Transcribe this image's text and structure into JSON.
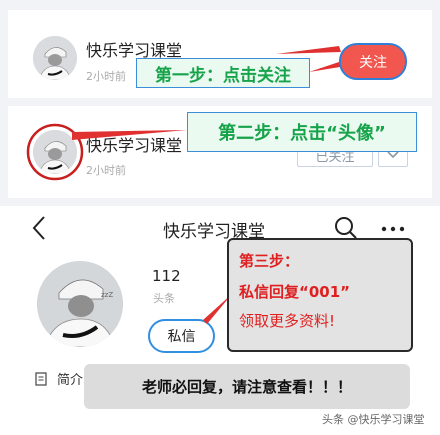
{
  "panel1": {
    "account_name": "快乐学习课堂",
    "time_text": "2小时前",
    "follow_label": "关注",
    "step_label": "第一步：点击关注"
  },
  "panel2": {
    "account_name": "快乐学习课堂",
    "time_text": "2小时前",
    "followed_label": "已关注",
    "step_label": "第二步：点击“头像”"
  },
  "profile": {
    "title": "快乐学习课堂",
    "stat_value": "112",
    "stat_label": "头条",
    "private_message_label": "私信",
    "intro_label": "简介"
  },
  "step3": {
    "title": "第三步：",
    "action": "私信回复“001”",
    "note": "领取更多资料!"
  },
  "bottom_notice": "老师必回复，请注意查看！！！",
  "watermark": "头条 @快乐学习课堂",
  "colors": {
    "accent_red": "#e03030",
    "follow_red": "#f2574f",
    "step_green": "#17a34a",
    "border_blue": "#2f7fd6"
  },
  "icons": [
    "back-icon",
    "search-icon",
    "more-icon",
    "chevron-down-icon",
    "document-icon"
  ]
}
